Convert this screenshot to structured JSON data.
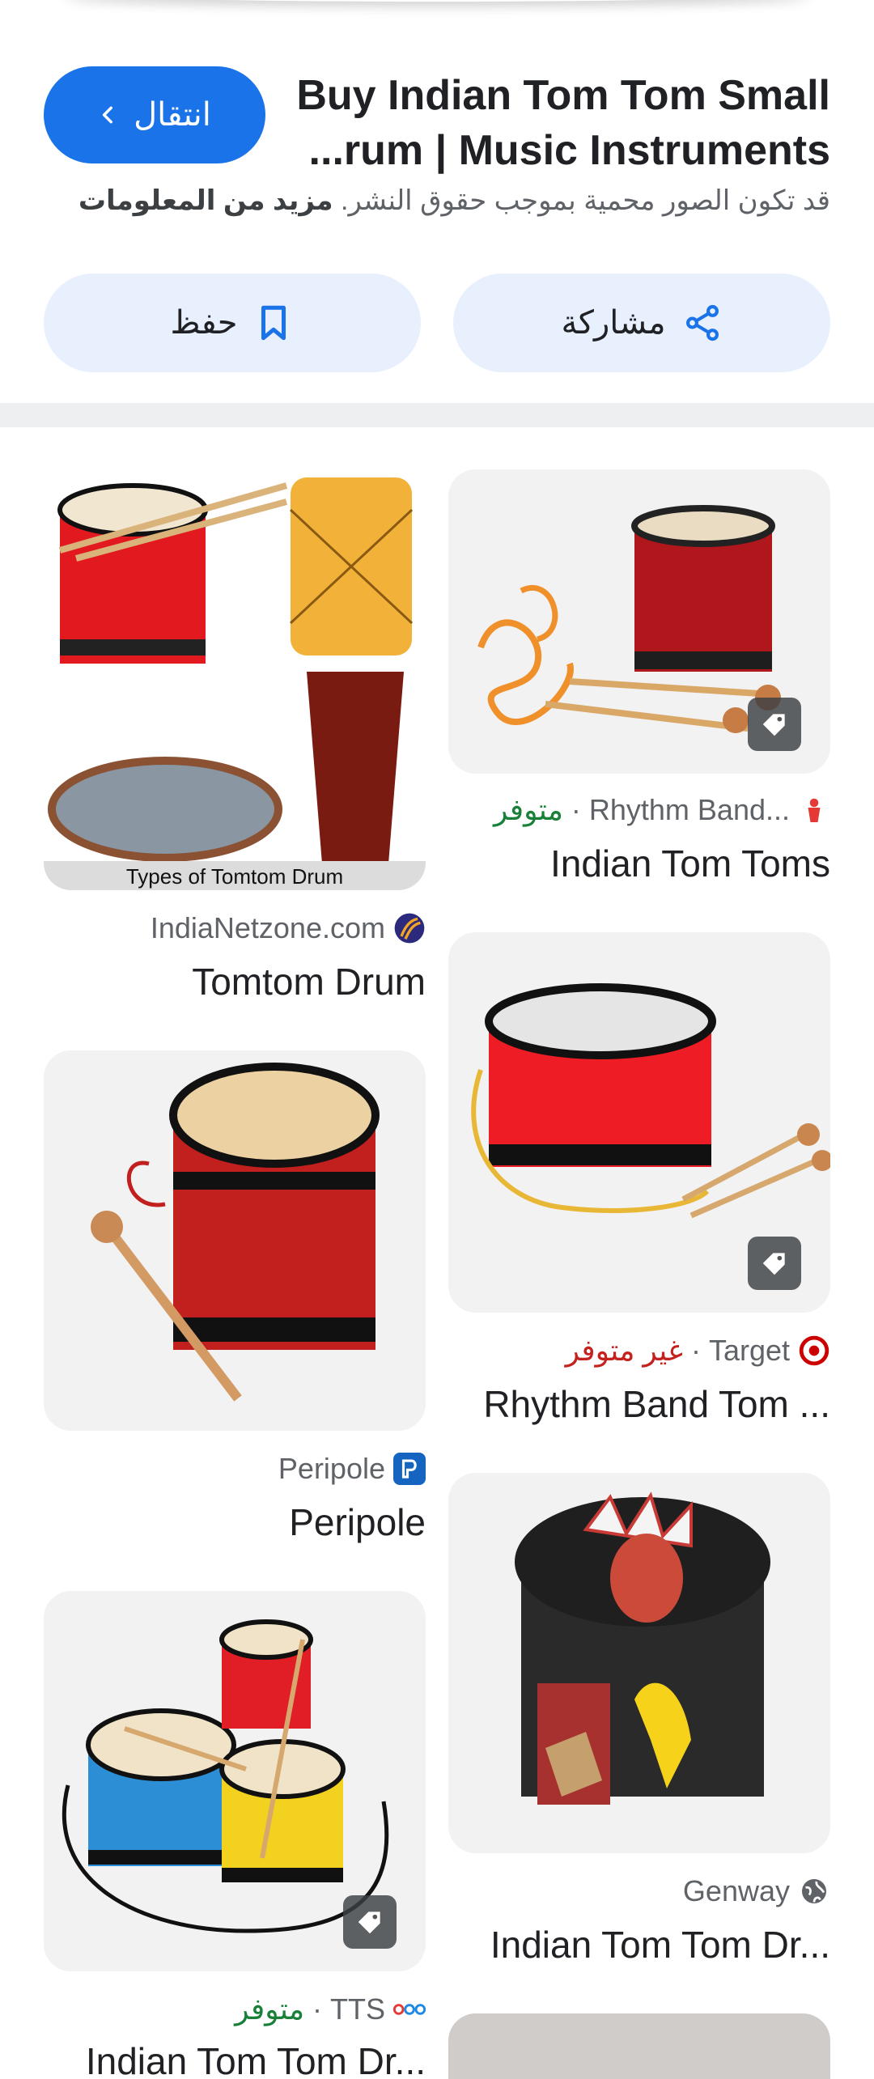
{
  "header": {
    "title": "Buy Indian Tom Tom Small Drum | Music Instruments...",
    "title_display_line1": "Buy Indian Tom Tom Small",
    "title_display_line2": "...rum | Music Instruments",
    "visit_label": "انتقال",
    "copyright_text": "قد تكون الصور محمية بموجب حقوق النشر.",
    "more_info_label": "مزيد من المعلومات",
    "share_label": "مشاركة",
    "save_label": "حفظ",
    "accent_color": "#1a73e8"
  },
  "results": [
    {
      "title": "Indian Tom Toms",
      "source": "Rhythm Band...",
      "availability": "متوفر",
      "availability_status": "in-stock",
      "has_tag": true,
      "image": "red-drum-with-cord-and-mallets",
      "favicon": "rhythm-band-icon"
    },
    {
      "title": "Tomtom Drum",
      "source": "IndiaNetzone.com",
      "image_caption": "Types of Tomtom Drum",
      "has_tag": false,
      "image": "tomtom-drum-collage",
      "favicon": "indianetzone-icon"
    },
    {
      "title": "Rhythm Band Tom ...",
      "source": "Target",
      "availability": "غير متوفر",
      "availability_status": "out-of-stock",
      "has_tag": true,
      "image": "red-floor-tom-with-mallets",
      "favicon": "target-icon"
    },
    {
      "title": "Peripole",
      "source": "Peripole",
      "has_tag": false,
      "image": "red-tom-with-mallet",
      "favicon": "peripole-icon"
    },
    {
      "title": "Indian Tom Tom Dr...",
      "source": "Genway",
      "has_tag": false,
      "image": "painted-native-drum",
      "favicon": "globe-icon"
    },
    {
      "title": "Indian Tom Tom Dr...",
      "source": "TTS",
      "availability": "متوفر",
      "availability_status": "in-stock",
      "has_tag": true,
      "image": "three-colored-tom-toms",
      "favicon": "tts-icon"
    }
  ]
}
